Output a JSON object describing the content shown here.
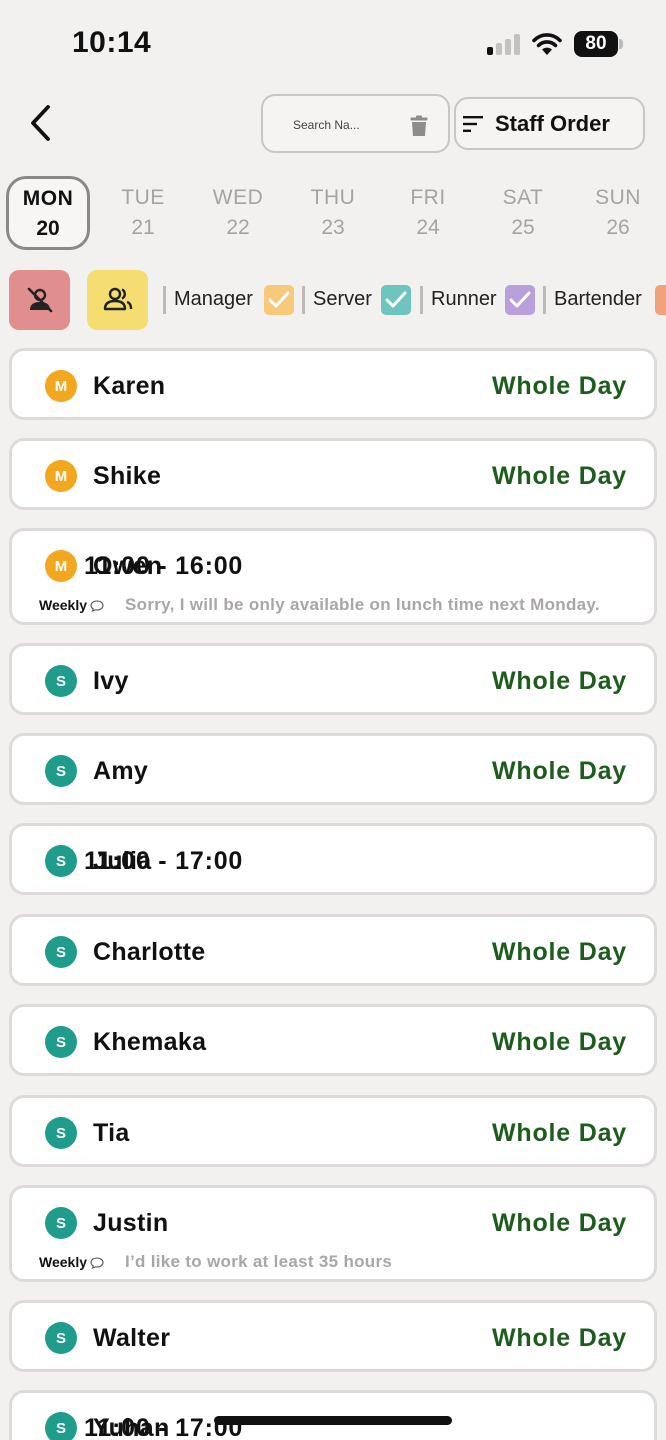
{
  "status": {
    "time": "10:14",
    "battery": "80"
  },
  "header": {
    "search_placeholder": "Search Na...",
    "staff_order_label": "Staff Order"
  },
  "days": [
    {
      "name": "MON",
      "num": "20"
    },
    {
      "name": "TUE",
      "num": "21"
    },
    {
      "name": "WED",
      "num": "22"
    },
    {
      "name": "THU",
      "num": "23"
    },
    {
      "name": "FRI",
      "num": "24"
    },
    {
      "name": "SAT",
      "num": "25"
    },
    {
      "name": "SUN",
      "num": "26"
    }
  ],
  "selected_day_index": 0,
  "roles": [
    {
      "label": "Manager",
      "color": "#f8c97b",
      "checked": true
    },
    {
      "label": "Server",
      "color": "#6ec5bd",
      "checked": true
    },
    {
      "label": "Runner",
      "color": "#b9a0dc",
      "checked": true
    },
    {
      "label": "Bartender",
      "color": "#f2a27a",
      "checked": true
    }
  ],
  "role_colors": {
    "M": "#f2a71f",
    "S": "#1f9c8c"
  },
  "staff": [
    {
      "initial": "M",
      "name": "Karen",
      "availability": "Whole Day",
      "whole_day": true
    },
    {
      "initial": "M",
      "name": "Shike",
      "availability": "Whole Day",
      "whole_day": true
    },
    {
      "initial": "M",
      "name": "Owen",
      "availability": "11:00 - 16:00",
      "whole_day": false,
      "note_tag": "Weekly",
      "note": "Sorry, I will be only available on lunch time next Monday."
    },
    {
      "initial": "S",
      "name": "Ivy",
      "availability": "Whole Day",
      "whole_day": true
    },
    {
      "initial": "S",
      "name": "Amy",
      "availability": "Whole Day",
      "whole_day": true
    },
    {
      "initial": "S",
      "name": "Julia",
      "availability": "11:00 - 17:00",
      "whole_day": false
    },
    {
      "initial": "S",
      "name": "Charlotte",
      "availability": "Whole Day",
      "whole_day": true
    },
    {
      "initial": "S",
      "name": "Khemaka",
      "availability": "Whole Day",
      "whole_day": true
    },
    {
      "initial": "S",
      "name": "Tia",
      "availability": "Whole Day",
      "whole_day": true
    },
    {
      "initial": "S",
      "name": "Justin",
      "availability": "Whole Day",
      "whole_day": true,
      "note_tag": "Weekly",
      "note": "I’d like to work at least 35 hours"
    },
    {
      "initial": "S",
      "name": "Walter",
      "availability": "Whole Day",
      "whole_day": true
    },
    {
      "initial": "S",
      "name": "Yuhan",
      "availability": "11:00 - 17:00",
      "whole_day": false
    }
  ]
}
